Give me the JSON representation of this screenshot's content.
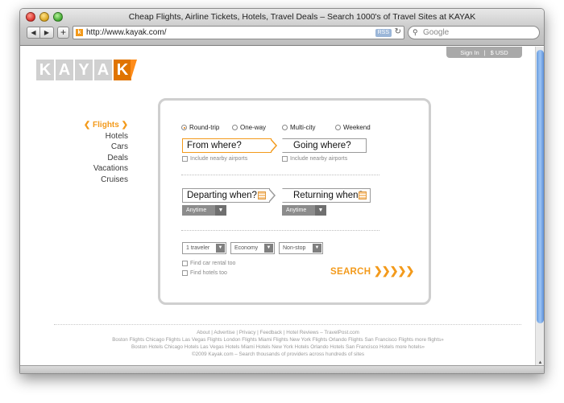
{
  "window": {
    "title": "Cheap Flights, Airline Tickets, Hotels, Travel Deals – Search 1000's of Travel Sites at KAYAK",
    "url": "http://www.kayak.com/",
    "rss_label": "RSS",
    "search_placeholder": "Google"
  },
  "header": {
    "sign_in": "Sign In",
    "currency": "$ USD",
    "logo_letters": [
      "K",
      "A",
      "Y",
      "A",
      "K"
    ]
  },
  "sidenav": {
    "items": [
      {
        "label": "Flights",
        "active": true
      },
      {
        "label": "Hotels"
      },
      {
        "label": "Cars"
      },
      {
        "label": "Deals"
      },
      {
        "label": "Vacations"
      },
      {
        "label": "Cruises"
      }
    ]
  },
  "form": {
    "trip_types": [
      {
        "label": "Round-trip",
        "selected": true
      },
      {
        "label": "One-way"
      },
      {
        "label": "Multi-city"
      },
      {
        "label": "Weekend"
      }
    ],
    "from_placeholder": "From where?",
    "to_placeholder": "Going where?",
    "nearby_from": "Include nearby airports",
    "nearby_to": "Include nearby airports",
    "depart_placeholder": "Departing when?",
    "return_placeholder": "Returning when?",
    "depart_time": "Anytime",
    "return_time": "Anytime",
    "travelers": "1 traveler",
    "cabin": "Economy",
    "stops": "Non-stop",
    "find_car": "Find car rental too",
    "find_hotels": "Find hotels too",
    "search_label": "SEARCH",
    "search_arrows": "❯❯❯❯❯"
  },
  "footer": {
    "links_line": "About  |  Advertise  |  Privacy  |  Feedback  |  Hotel Reviews – TravelPost.com",
    "flights_line": "Boston Flights Chicago Flights Las Vegas Flights London Flights Miami Flights New York Flights Orlando Flights San Francisco Flights more flights»",
    "hotels_line": "Boston Hotels Chicago Hotels Las Vegas Hotels Miami Hotels New York Hotels Orlando Hotels San Francisco Hotels more hotels»",
    "copyright": "©2009 Kayak.com – Search thousands of providers across hundreds of sites"
  },
  "colors": {
    "accent": "#f39a1b",
    "logo_gray": "#d0d0d0",
    "card_border": "#cfcfcf"
  }
}
